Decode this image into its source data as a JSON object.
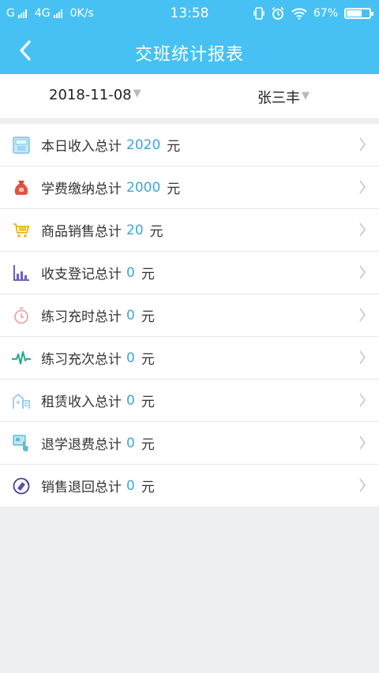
{
  "status_bar": {
    "carrier_left": "G",
    "network": "4G",
    "speed": "0K/s",
    "time": "13:58",
    "battery_percent": "67%",
    "battery_level": 0.67,
    "icons": [
      "signal-icon",
      "vibrate-icon",
      "alarm-icon",
      "wifi-icon",
      "battery-icon"
    ]
  },
  "header": {
    "title": "交班统计报表",
    "back_icon": "chevron-left-icon"
  },
  "filters": {
    "date": "2018-11-08",
    "person": "张三丰",
    "caret": "▼"
  },
  "colors": {
    "primary": "#47c1f4",
    "value": "#3ea6d6",
    "background": "#eeeff1"
  },
  "stats": [
    {
      "label": "本日收入总计",
      "value": "2020",
      "unit": "元",
      "icon": "wallet-icon"
    },
    {
      "label": "学费缴纳总计",
      "value": "2000",
      "unit": "元",
      "icon": "money-bag-icon"
    },
    {
      "label": "商品销售总计",
      "value": "20",
      "unit": "元",
      "icon": "cart-icon"
    },
    {
      "label": "收支登记总计",
      "value": "0",
      "unit": "元",
      "icon": "bar-chart-icon"
    },
    {
      "label": "练习充时总计",
      "value": "0",
      "unit": "元",
      "icon": "stopwatch-icon"
    },
    {
      "label": "练习充次总计",
      "value": "0",
      "unit": "元",
      "icon": "pulse-icon"
    },
    {
      "label": "租赁收入总计",
      "value": "0",
      "unit": "元",
      "icon": "building-icon"
    },
    {
      "label": "退学退费总计",
      "value": "0",
      "unit": "元",
      "icon": "refund-icon"
    },
    {
      "label": "销售退回总计",
      "value": "0",
      "unit": "元",
      "icon": "return-icon"
    }
  ]
}
